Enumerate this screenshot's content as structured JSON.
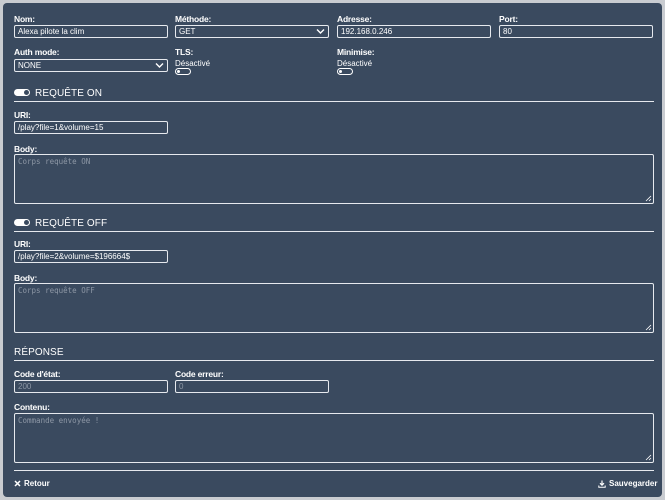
{
  "general": {
    "nom_label": "Nom:",
    "nom_value": "Alexa pilote la clim",
    "methode_label": "Méthode:",
    "methode_value": "GET",
    "adresse_label": "Adresse:",
    "adresse_value": "192.168.0.246",
    "port_label": "Port:",
    "port_value": "80",
    "auth_label": "Auth mode:",
    "auth_value": "NONE",
    "tls_label": "TLS:",
    "tls_state": "Désactivé",
    "minimise_label": "Minimise:",
    "minimise_state": "Désactivé"
  },
  "request_on": {
    "title": "REQUÊTE ON",
    "uri_label": "URI:",
    "uri_value": "/play?file=1&volume=15",
    "body_label": "Body:",
    "body_placeholder": "Corps requête ON"
  },
  "request_off": {
    "title": "REQUÊTE OFF",
    "uri_label": "URI:",
    "uri_value": "/play?file=2&volume=$196664$",
    "body_label": "Body:",
    "body_placeholder": "Corps requête OFF"
  },
  "response": {
    "title": "RÉPONSE",
    "code_etat_label": "Code d'état:",
    "code_etat_value": "200",
    "code_erreur_label": "Code erreur:",
    "code_erreur_value": "0",
    "contenu_label": "Contenu:",
    "contenu_value": "Commande envoyée !"
  },
  "footer": {
    "retour_label": "Retour",
    "sauvegarder_label": "Sauvegarder"
  },
  "icons": {
    "retour": "close-x-icon",
    "sauvegarder": "download-icon",
    "select": "chevron-down-icon",
    "resize": "resize-grip-icon"
  },
  "colors": {
    "panel": "#3a4a5f",
    "border": "#e6e9ee",
    "placeholder": "#8d97a5"
  }
}
